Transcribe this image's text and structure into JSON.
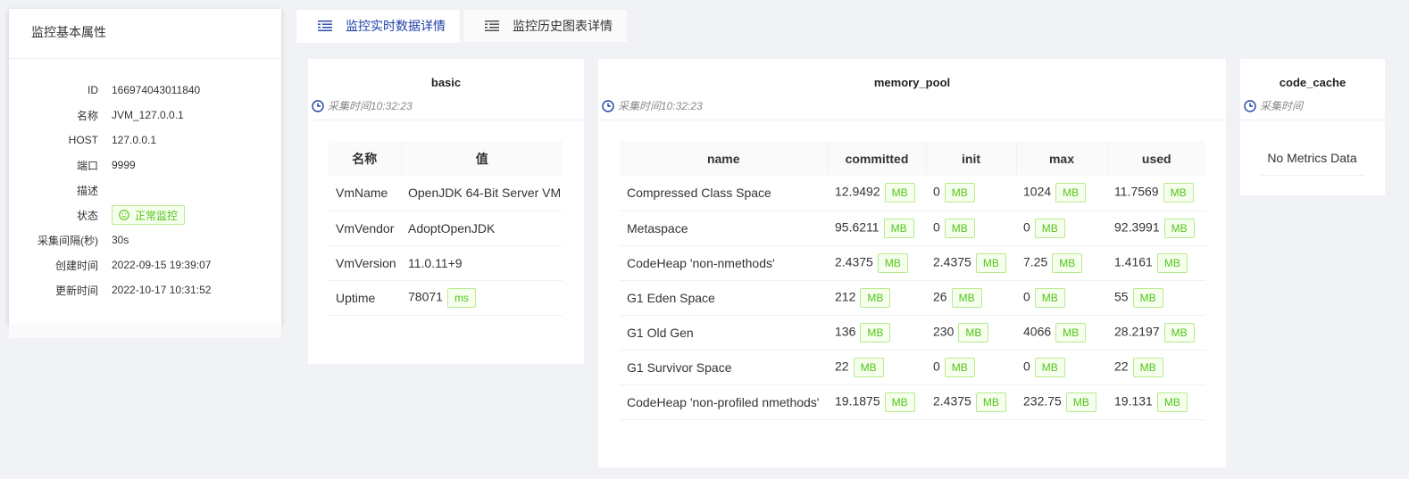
{
  "info": {
    "title": "监控基本属性",
    "rows": [
      {
        "label": "ID",
        "value": "166974043011840"
      },
      {
        "label": "名称",
        "value": "JVM_127.0.0.1"
      },
      {
        "label": "HOST",
        "value": "127.0.0.1"
      },
      {
        "label": "端口",
        "value": "9999"
      },
      {
        "label": "描述",
        "value": ""
      },
      {
        "label": "状态",
        "value": ""
      },
      {
        "label": "采集间隔(秒)",
        "value": "30s"
      },
      {
        "label": "创建时间",
        "value": "2022-09-15 19:39:07"
      },
      {
        "label": "更新时间",
        "value": "2022-10-17 10:31:52"
      }
    ],
    "status": "正常监控",
    "status_color": "#52c41a"
  },
  "tabs": [
    {
      "label": "监控实时数据详情",
      "active": true
    },
    {
      "label": "监控历史图表详情",
      "active": false
    }
  ],
  "basic": {
    "title": "basic",
    "time": "采集时间10:32:23",
    "headers": [
      "名称",
      "值"
    ],
    "rows": [
      {
        "name": "VmName",
        "value": "OpenJDK 64-Bit Server VM",
        "unit": ""
      },
      {
        "name": "VmVendor",
        "value": "AdoptOpenJDK",
        "unit": ""
      },
      {
        "name": "VmVersion",
        "value": "11.0.11+9",
        "unit": ""
      },
      {
        "name": "Uptime",
        "value": "78071",
        "unit": "ms"
      }
    ]
  },
  "memory_pool": {
    "title": "memory_pool",
    "time": "采集时间10:32:23",
    "headers": [
      "name",
      "committed",
      "init",
      "max",
      "used"
    ],
    "unit": "MB",
    "rows": [
      [
        "Compressed Class Space",
        "12.9492",
        "0",
        "1024",
        "11.7569"
      ],
      [
        "Metaspace",
        "95.6211",
        "0",
        "0",
        "92.3991"
      ],
      [
        "CodeHeap 'non-nmethods'",
        "2.4375",
        "2.4375",
        "7.25",
        "1.4161"
      ],
      [
        "G1 Eden Space",
        "212",
        "26",
        "0",
        "55"
      ],
      [
        "G1 Old Gen",
        "136",
        "230",
        "4066",
        "28.2197"
      ],
      [
        "G1 Survivor Space",
        "22",
        "0",
        "0",
        "22"
      ],
      [
        "CodeHeap 'non-profiled nmethods'",
        "19.1875",
        "2.4375",
        "232.75",
        "19.131"
      ]
    ]
  },
  "code_cache": {
    "title": "code_cache",
    "time": "采集时间",
    "empty": "No Metrics Data"
  },
  "colors": {
    "accent": "#1f3fa8",
    "tag_green": "#52c41a",
    "tag_green_bg": "#f6ffed",
    "tag_green_border": "#b7eb8f"
  }
}
